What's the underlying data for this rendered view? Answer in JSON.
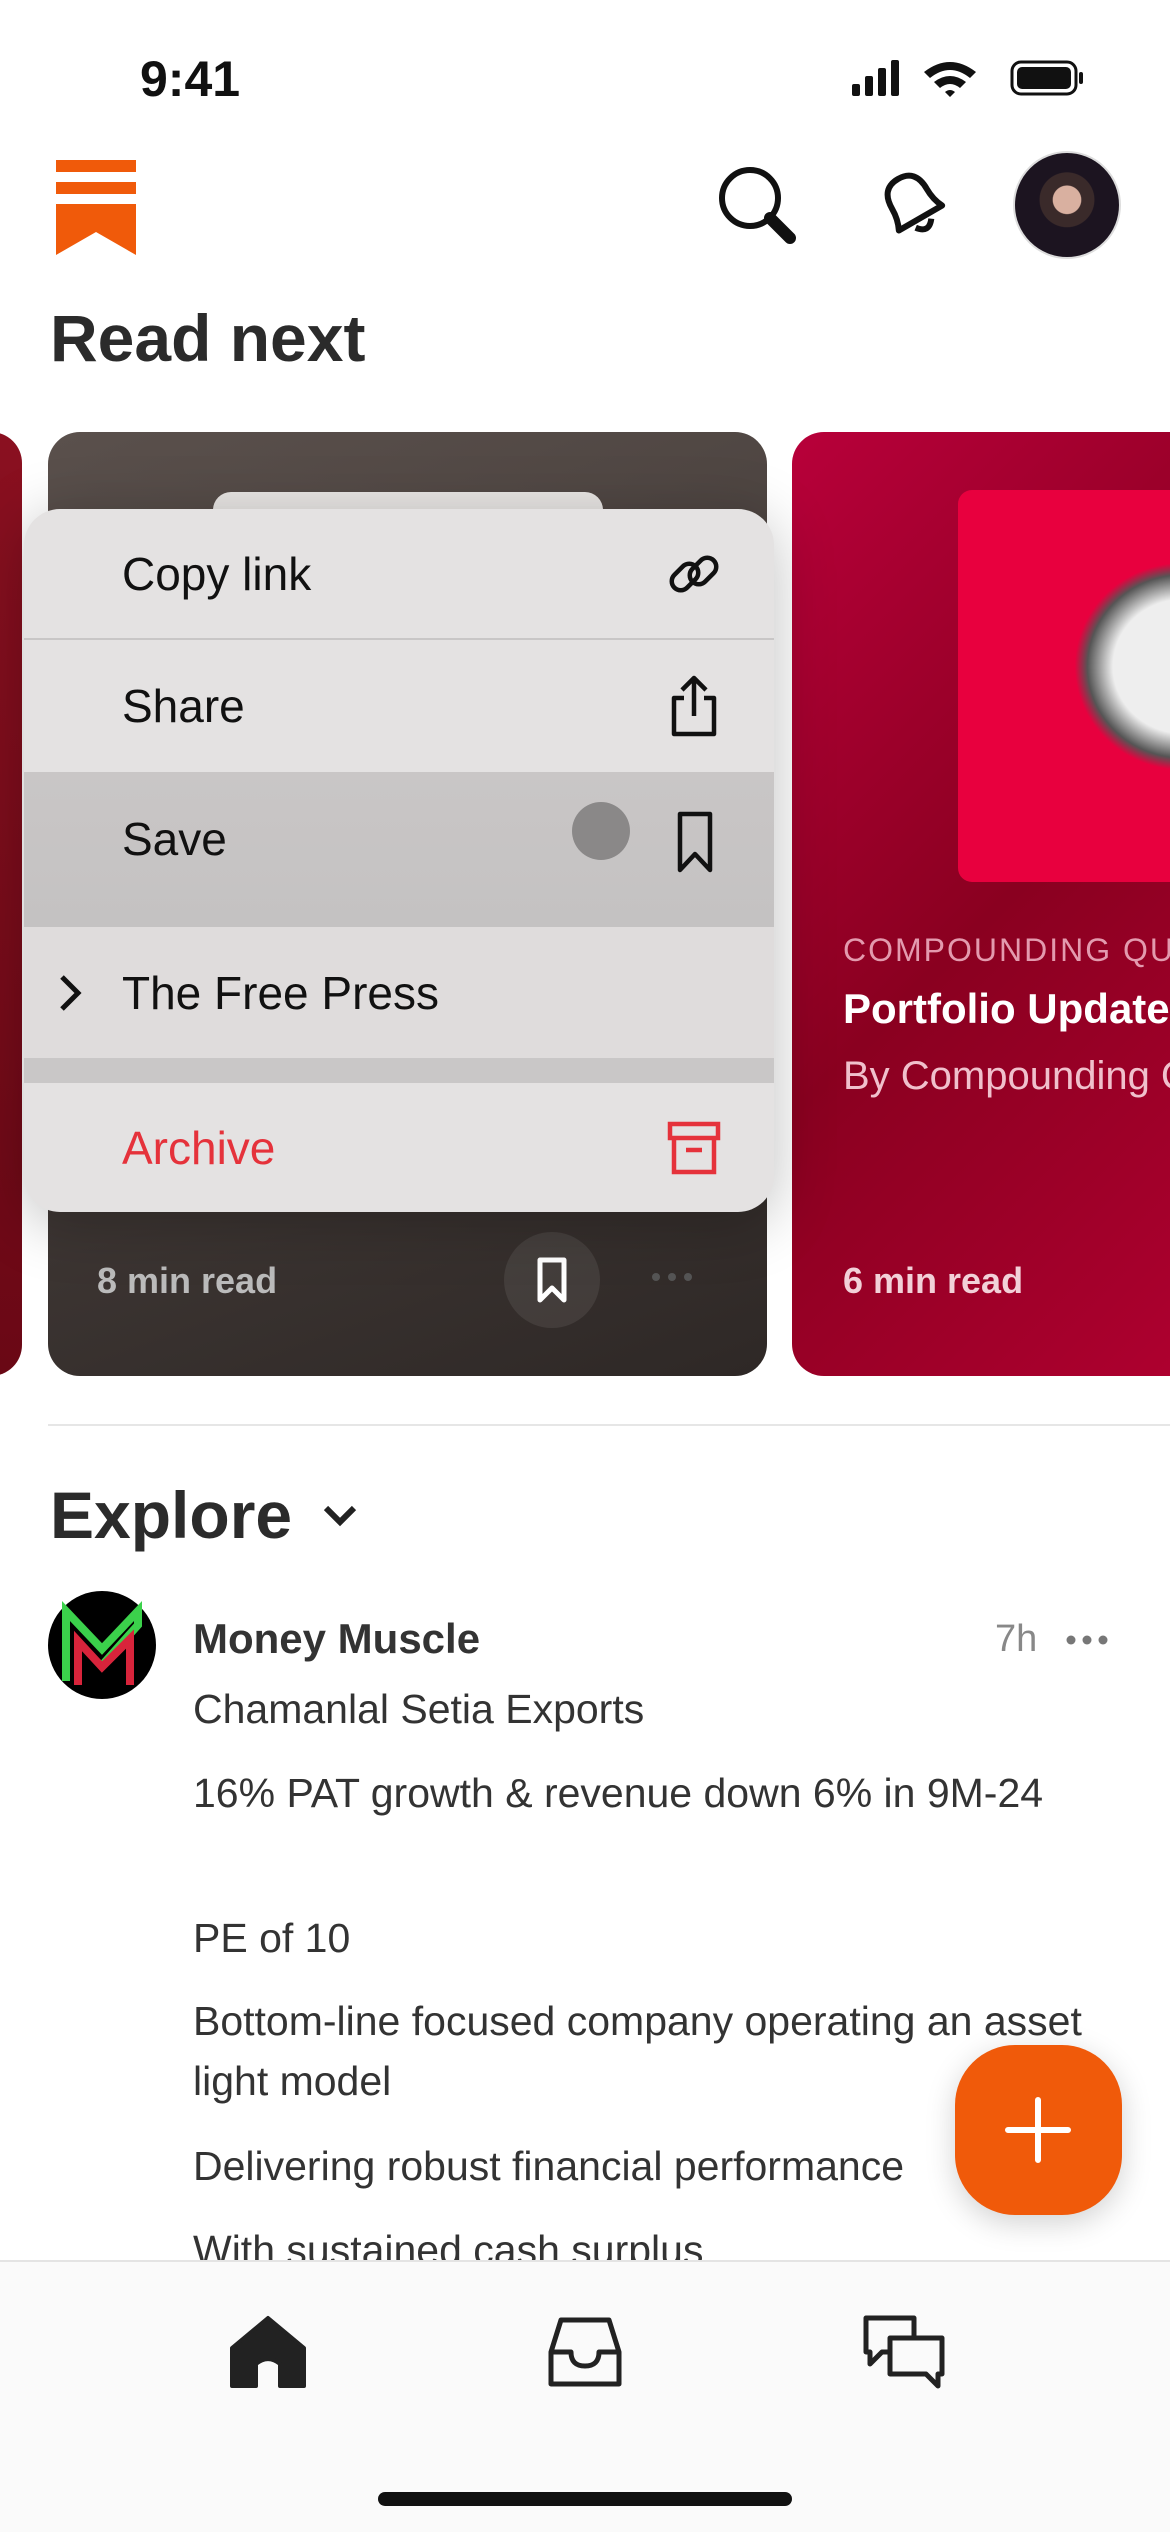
{
  "status": {
    "time": "9:41"
  },
  "header": {
    "section_title": "Read next"
  },
  "context_menu": {
    "items": [
      {
        "label": "Copy link",
        "icon": "link-icon"
      },
      {
        "label": "Share",
        "icon": "share-icon"
      },
      {
        "label": "Save",
        "icon": "bookmark-icon"
      },
      {
        "label": "The Free Press",
        "icon": "chevron-right-icon"
      },
      {
        "label": "Archive",
        "icon": "archive-icon"
      }
    ],
    "archive_color": "#e5323b"
  },
  "cards": [
    {
      "read_time": "8 min read"
    },
    {
      "publication": "COMPOUNDING QUALITY",
      "title": "Portfolio Update",
      "author": "By Compounding Quality",
      "read_time": "6 min read"
    }
  ],
  "explore": {
    "title": "Explore",
    "post": {
      "author": "Money Muscle",
      "time": "7h",
      "lines": [
        "Chamanlal Setia Exports",
        "16% PAT growth & revenue down 6% in 9M-24",
        "PE of 10",
        "Bottom-line focused company operating an asset light model",
        "Delivering robust financial performance",
        "With sustained cash surplus"
      ]
    }
  },
  "colors": {
    "brand": "#f05a0a",
    "card_red": "#a8002a"
  }
}
